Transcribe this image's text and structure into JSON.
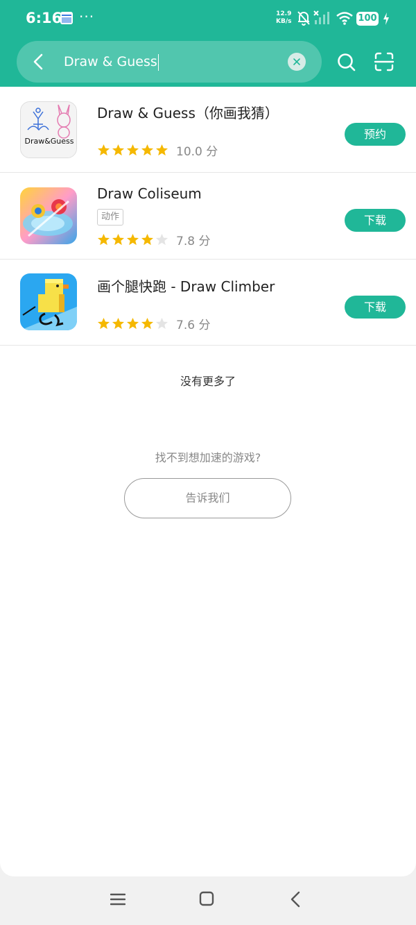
{
  "status_bar": {
    "time": "6:16",
    "more": "···",
    "net_speed_value": "12.9",
    "net_speed_unit": "KB/s",
    "battery": "100",
    "icons": [
      "calendar-icon",
      "bell-muted-icon",
      "signal-off-icon",
      "wifi-icon",
      "charging-icon"
    ]
  },
  "search": {
    "value": "Draw & Guess",
    "icons": [
      "back-arrow-icon",
      "clear-icon",
      "search-icon",
      "scan-icon"
    ]
  },
  "results": [
    {
      "name": "Draw & Guess（你画我猜）",
      "tag": "",
      "rating": 5,
      "score": "10.0 分",
      "action": "预约",
      "icon_label": "Draw&Guess",
      "icon_colors": [
        "#f4f4f4",
        "#3a6fd8",
        "#e47ab0"
      ]
    },
    {
      "name": "Draw Coliseum",
      "tag": "动作",
      "rating": 4,
      "score": "7.8 分",
      "action": "下载",
      "icon_colors": [
        "#ffd33a",
        "#3aa5e8",
        "#e8384a"
      ]
    },
    {
      "name": "画个腿快跑 - Draw Climber",
      "tag": "",
      "rating": 4,
      "score": "7.6 分",
      "action": "下载",
      "icon_colors": [
        "#2ba7f0",
        "#f7e048",
        "#e6b020"
      ]
    }
  ],
  "footer": {
    "end_of_list": "没有更多了",
    "not_found_prompt": "找不到想加速的游戏?",
    "tell_us_button": "告诉我们"
  },
  "nav_bar": {
    "icons": [
      "menu-icon",
      "home-icon",
      "back-icon"
    ]
  },
  "colors": {
    "accent": "#20b798",
    "star_filled": "#f5b800",
    "star_empty": "#e4e4e4"
  }
}
